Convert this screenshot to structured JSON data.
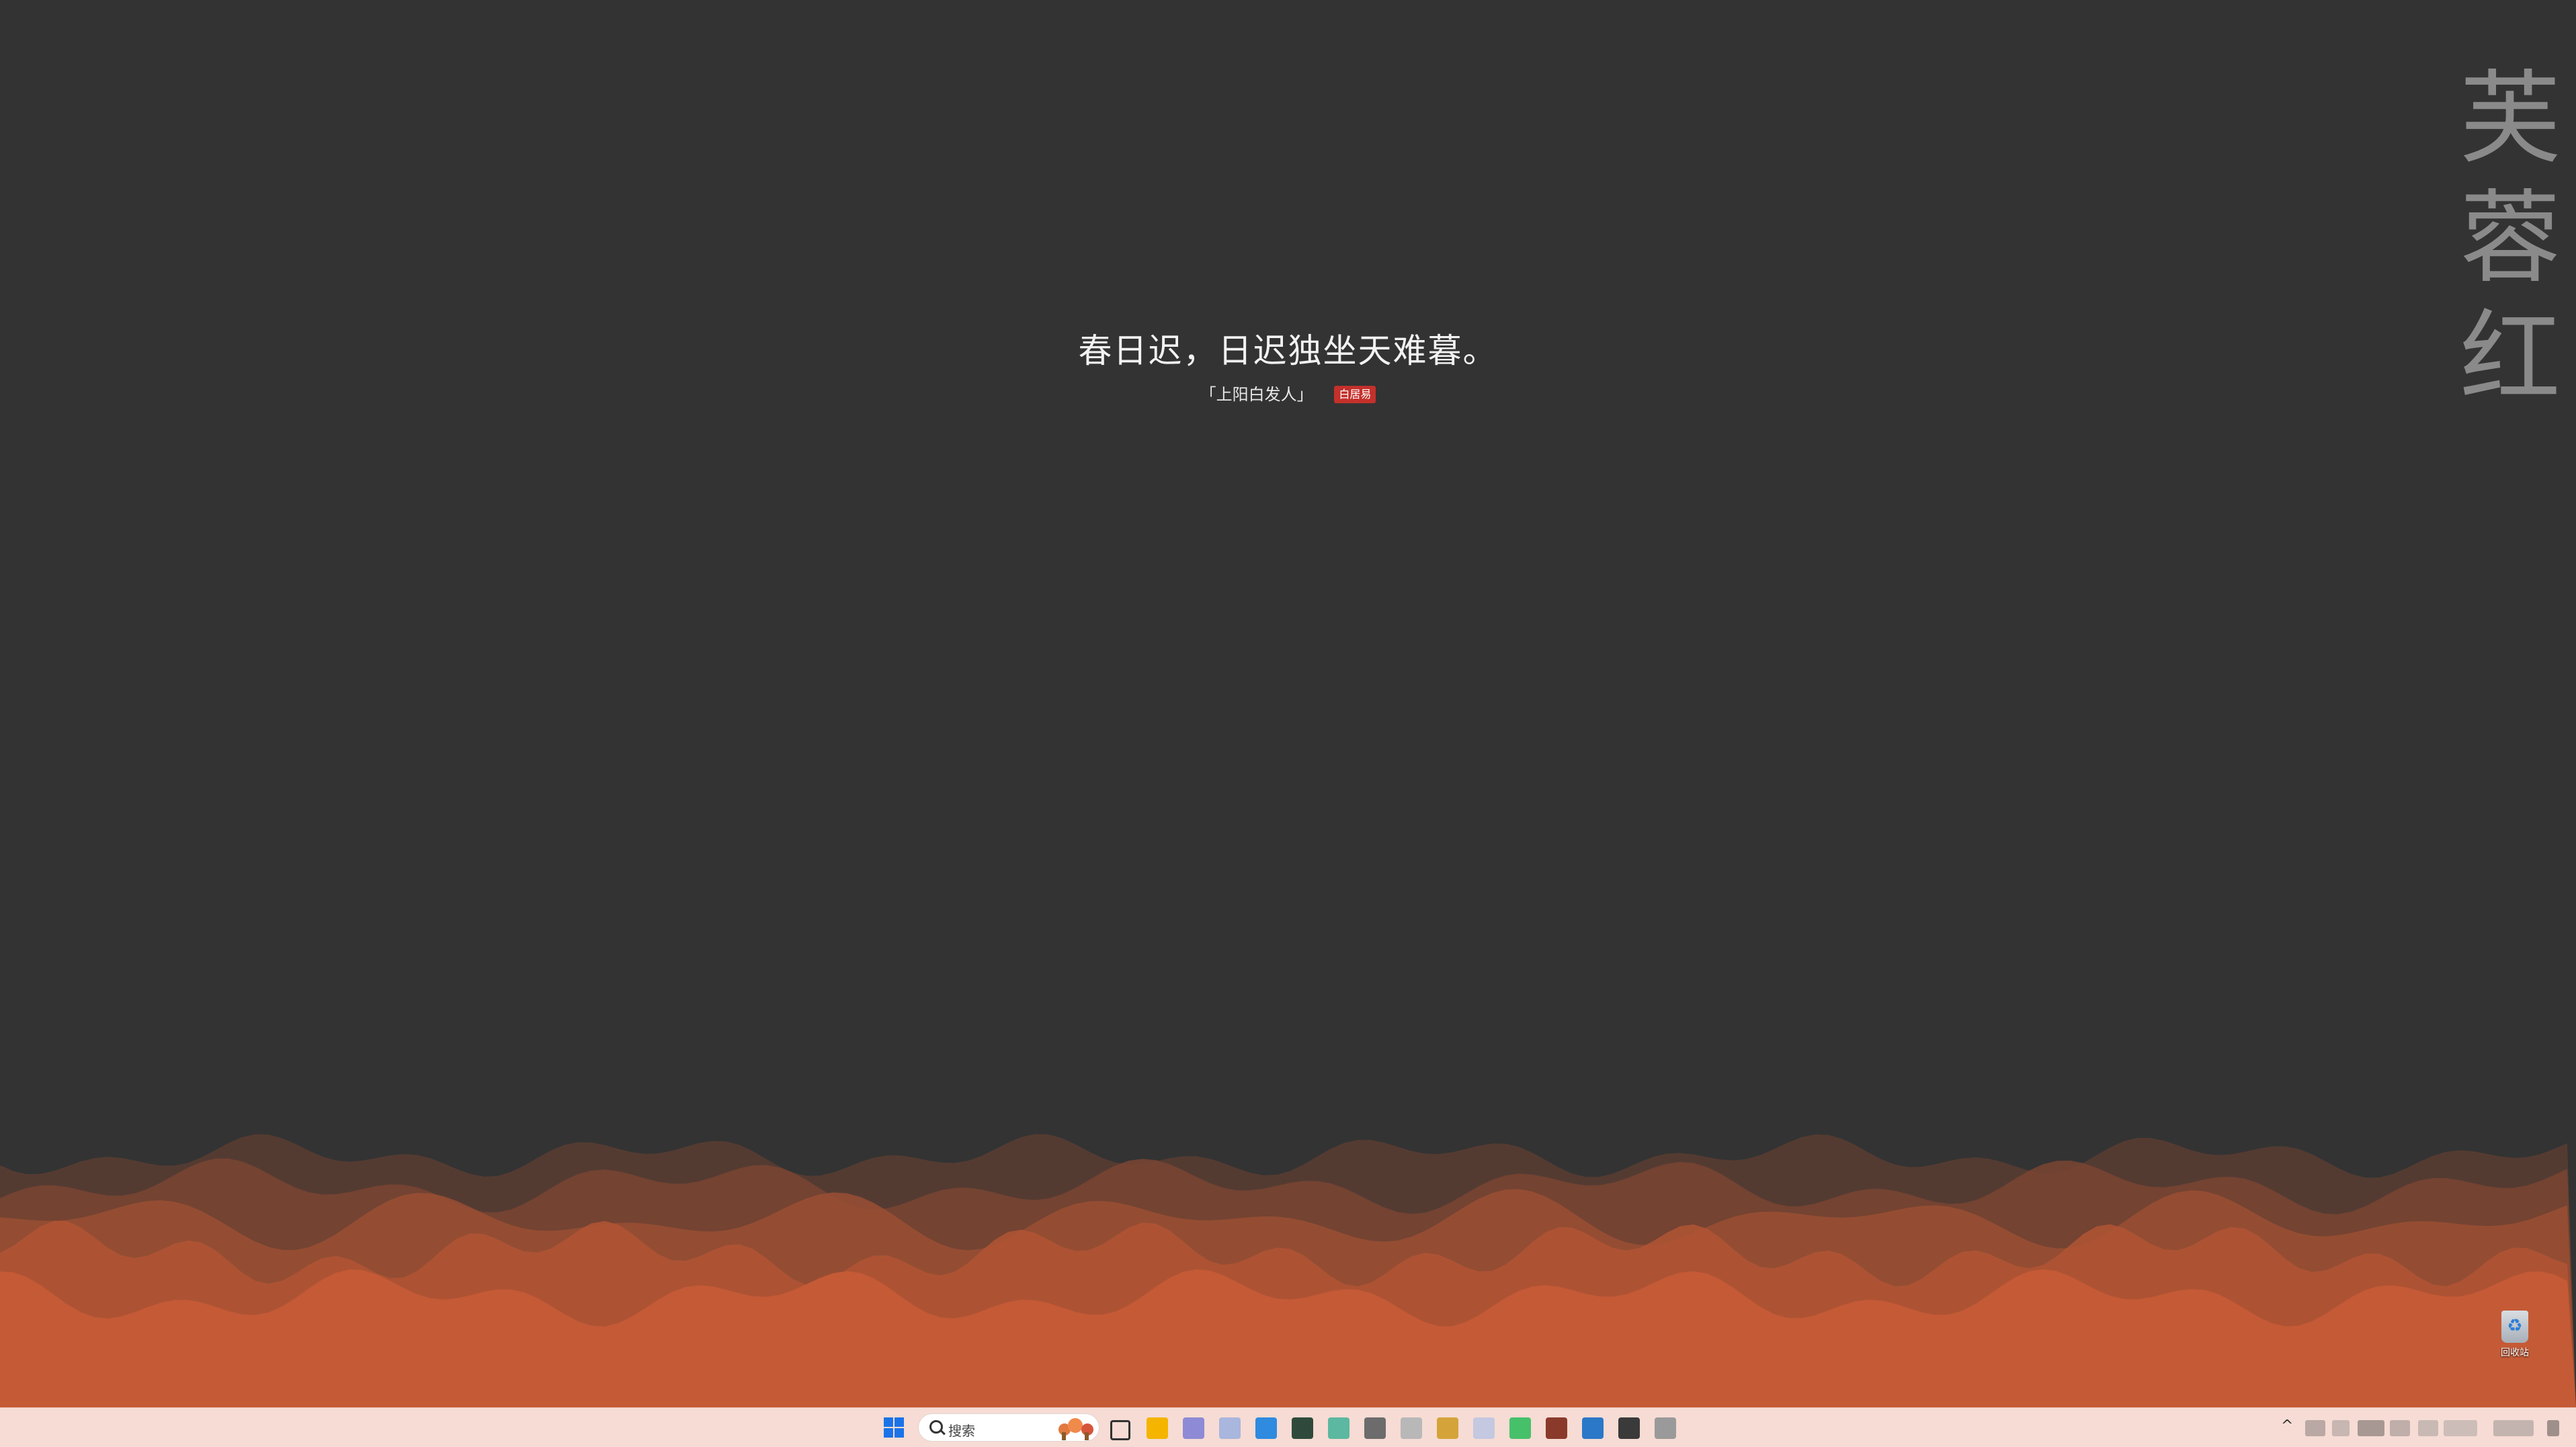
{
  "wallpaper": {
    "poem_line": "春日迟，日迟独坐天难暮。",
    "poem_source": "「上阳白发人」",
    "poem_author": "白居易",
    "vertical_title": [
      "芙",
      "蓉",
      "红"
    ],
    "background_color": "#333333",
    "wave_colors": [
      "#5a3d33",
      "#7a4533",
      "#9a4f34",
      "#b25535",
      "#c55a36"
    ]
  },
  "desktop_icons": [
    {
      "name": "recycle-bin",
      "label": "回收站"
    }
  ],
  "taskbar": {
    "background": "#f6dcd4",
    "search_placeholder": "搜索",
    "pinned_apps": [
      {
        "name": "task-view-icon",
        "color": "#333333"
      },
      {
        "name": "file-explorer-icon",
        "color": "#f4b400"
      },
      {
        "name": "app-icon-1",
        "color": "#8e8ad6"
      },
      {
        "name": "app-icon-2",
        "color": "#a9b6dd"
      },
      {
        "name": "app-icon-3",
        "color": "#2f8bdf"
      },
      {
        "name": "app-icon-4",
        "color": "#2f4a3c"
      },
      {
        "name": "app-icon-5",
        "color": "#5cb8a0"
      },
      {
        "name": "app-icon-6",
        "color": "#6c6c6c"
      },
      {
        "name": "app-icon-7",
        "color": "#b8b8b8"
      },
      {
        "name": "app-icon-8",
        "color": "#d4a43a"
      },
      {
        "name": "app-icon-9",
        "color": "#c4c8e0"
      },
      {
        "name": "app-icon-10",
        "color": "#47c06a"
      },
      {
        "name": "app-icon-11",
        "color": "#8a3a2a"
      },
      {
        "name": "app-icon-12",
        "color": "#2b78c8"
      },
      {
        "name": "app-icon-13",
        "color": "#3a3a3a"
      },
      {
        "name": "app-icon-14",
        "color": "#9a9a9a"
      }
    ],
    "tray_chevron": "^"
  }
}
